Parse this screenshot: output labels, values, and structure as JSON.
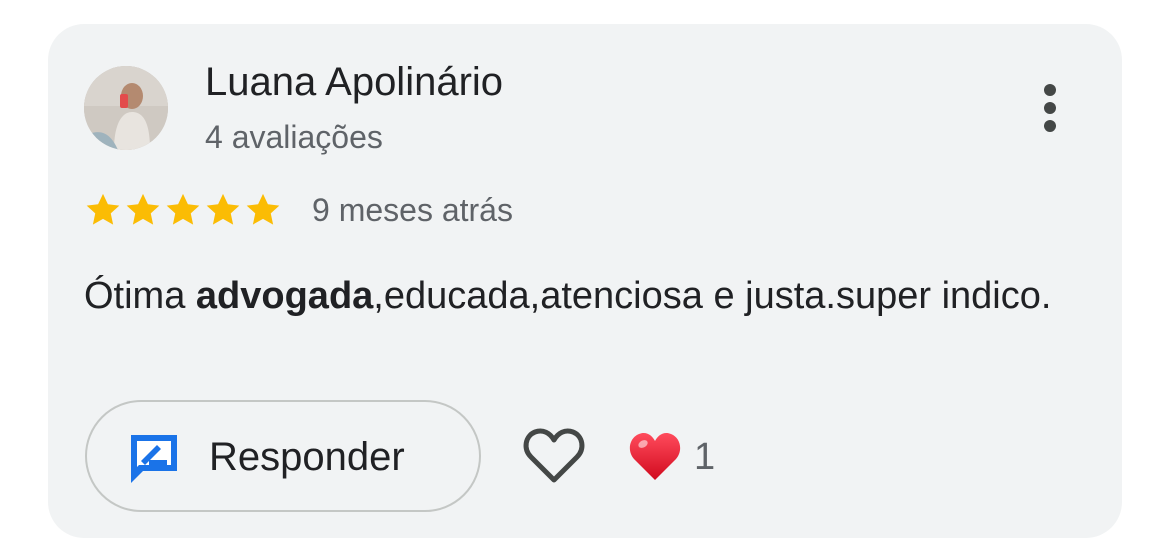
{
  "review": {
    "author_name": "Luana Apolinário",
    "review_count": "4 avaliações",
    "rating": 5,
    "rating_max": 5,
    "time_ago": "9 meses atrás",
    "text_before_bold": "Ótima ",
    "text_bold": "advogada",
    "text_after_bold": ",educada,atenciosa e justa.super indico."
  },
  "actions": {
    "reply_label": "Responder",
    "reaction_count": "1"
  },
  "colors": {
    "card_background": "#f1f3f4",
    "star": "#fbbc04",
    "reply_icon": "#1a73e8",
    "heart": "#e8112d"
  },
  "icons": {
    "more": "more-vert-icon",
    "reply": "reply-edit-icon",
    "like": "heart-outline-icon",
    "reaction": "red-heart-emoji"
  }
}
